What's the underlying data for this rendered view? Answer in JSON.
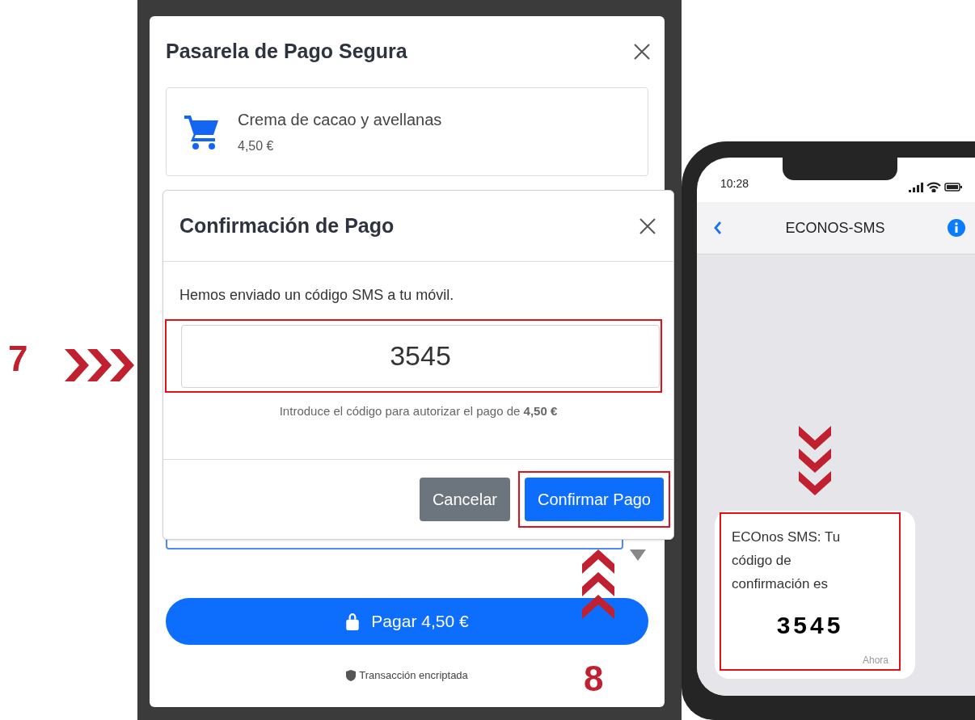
{
  "step_markers": [
    {
      "label": "7"
    },
    {
      "label": "8"
    }
  ],
  "payment_modal": {
    "title": "Pasarela de Pago Segura",
    "product": {
      "name": "Crema de cacao y avellanas",
      "price": "4,50 €"
    },
    "pay_button": "Pagar 4,50 €",
    "footer_note": "Transacción encriptada"
  },
  "confirm_modal": {
    "title": "Confirmación de Pago",
    "message": "Hemos enviado un código SMS a tu móvil.",
    "code_input": {
      "value": "3545"
    },
    "hint": "Introduce el código para autorizar el pago de **4,50 €**",
    "buttons": [
      {
        "label": "Cancelar",
        "kind": "secondary"
      },
      {
        "label": "Confirmar Pago",
        "kind": "primary"
      }
    ]
  },
  "phone": {
    "time": "10:28",
    "contact": "ECONOS-SMS",
    "message": {
      "text": "ECOnos SMS: Tu código de confirmación es",
      "code": "3545",
      "time": "Ahora"
    }
  }
}
